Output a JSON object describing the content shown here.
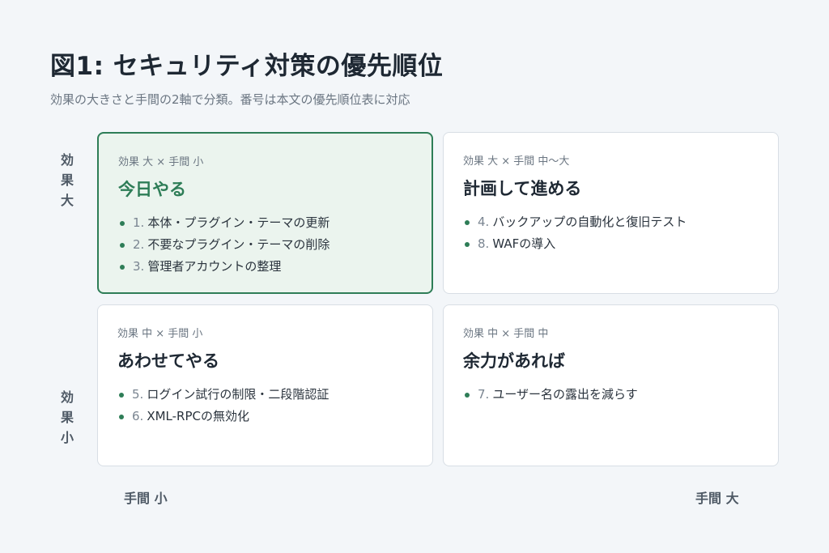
{
  "title": "図1: セキュリティ対策の優先順位",
  "subtitle": "効果の大きさと手間の2軸で分類。番号は本文の優先順位表に対応",
  "axes": {
    "y_top": [
      "効",
      "果",
      "大"
    ],
    "y_bottom": [
      "効",
      "果",
      "小"
    ],
    "x_left": "手間 小",
    "x_right": "手間 大"
  },
  "quadrants": [
    {
      "meta": "効果 大 × 手間 小",
      "title": "今日やる",
      "items": [
        {
          "num": "1.",
          "text": "本体・プラグイン・テーマの更新"
        },
        {
          "num": "2.",
          "text": "不要なプラグイン・テーマの削除"
        },
        {
          "num": "3.",
          "text": "管理者アカウントの整理"
        }
      ]
    },
    {
      "meta": "効果 大 × 手間 中〜大",
      "title": "計画して進める",
      "items": [
        {
          "num": "4.",
          "text": "バックアップの自動化と復旧テスト"
        },
        {
          "num": "8.",
          "text": "WAFの導入"
        }
      ]
    },
    {
      "meta": "効果 中 × 手間 小",
      "title": "あわせてやる",
      "items": [
        {
          "num": "5.",
          "text": "ログイン試行の制限・二段階認証"
        },
        {
          "num": "6.",
          "text": "XML-RPCの無効化"
        }
      ]
    },
    {
      "meta": "効果 中 × 手間 中",
      "title": "余力があれば",
      "items": [
        {
          "num": "7.",
          "text": "ユーザー名の露出を減らす"
        }
      ]
    }
  ],
  "colors": {
    "accent": "#2e7d57",
    "highlight_bg": "#ebf4ee",
    "background": "#f3f6f9"
  }
}
